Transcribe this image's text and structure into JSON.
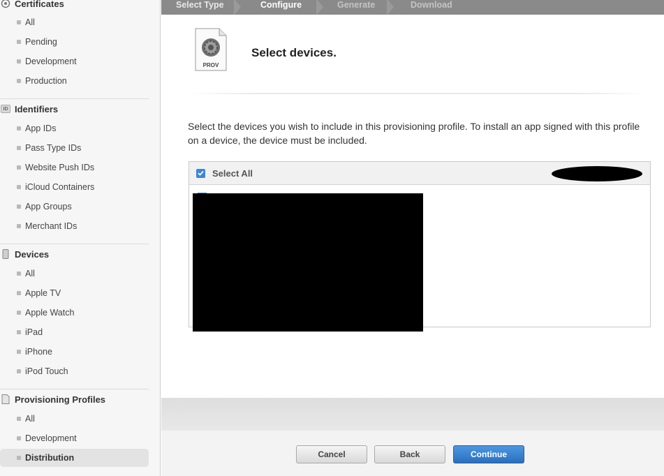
{
  "sidebar": {
    "certificates": {
      "title": "Certificates",
      "items": [
        "All",
        "Pending",
        "Development",
        "Production"
      ]
    },
    "identifiers": {
      "title": "Identifiers",
      "icon_text": "ID",
      "items": [
        "App IDs",
        "Pass Type IDs",
        "Website Push IDs",
        "iCloud Containers",
        "App Groups",
        "Merchant IDs"
      ]
    },
    "devices": {
      "title": "Devices",
      "items": [
        "All",
        "Apple TV",
        "Apple Watch",
        "iPad",
        "iPhone",
        "iPod Touch"
      ]
    },
    "profiles": {
      "title": "Provisioning Profiles",
      "items": [
        "All",
        "Development",
        "Distribution"
      ],
      "active": "Distribution"
    }
  },
  "steps": [
    "Select Type",
    "Configure",
    "Generate",
    "Download"
  ],
  "header": {
    "icon_label": "PROV",
    "title": "Select devices."
  },
  "description": "Select the devices you wish to include in this provisioning profile. To install an app signed with this profile on a device, the device must be included.",
  "device_list": {
    "select_all_label": "Select All",
    "select_all_checked": true
  },
  "buttons": {
    "cancel": "Cancel",
    "back": "Back",
    "continue": "Continue"
  },
  "colors": {
    "accent": "#3d87d6",
    "stepbar": "#8a8a8a"
  }
}
